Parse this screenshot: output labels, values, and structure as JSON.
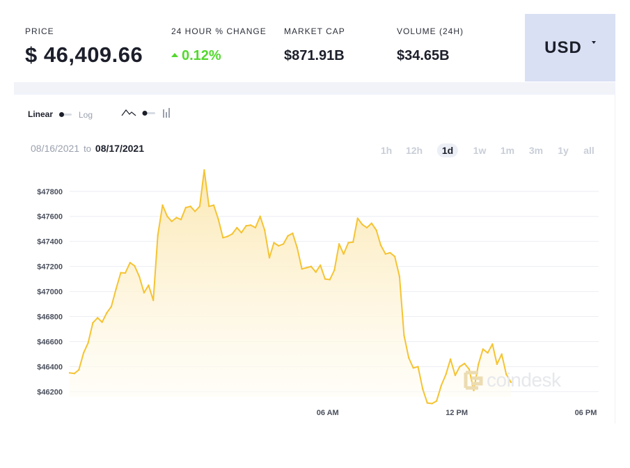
{
  "stats": {
    "price": {
      "label": "PRICE",
      "value": "$ 46,409.66"
    },
    "change": {
      "label": "24 HOUR % CHANGE",
      "value": "0.12%"
    },
    "market_cap": {
      "label": "MARKET CAP",
      "value": "$871.91B"
    },
    "volume": {
      "label": "VOLUME (24H)",
      "value": "$34.65B"
    }
  },
  "currency": {
    "label": "USD"
  },
  "controls": {
    "scale_linear": "Linear",
    "scale_log": "Log",
    "scale_selected": "Linear",
    "chart_type_selected": "line"
  },
  "dates": {
    "from": "08/16/2021",
    "to_word": "to",
    "to": "08/17/2021"
  },
  "ranges": [
    {
      "label": "1h",
      "active": false
    },
    {
      "label": "12h",
      "active": false
    },
    {
      "label": "1d",
      "active": true
    },
    {
      "label": "1w",
      "active": false
    },
    {
      "label": "1m",
      "active": false
    },
    {
      "label": "3m",
      "active": false
    },
    {
      "label": "1y",
      "active": false
    },
    {
      "label": "all",
      "active": false
    }
  ],
  "watermark": {
    "text": "coindesk"
  },
  "colors": {
    "line": "#f5c332",
    "fill_top": "#fbe7b0",
    "fill_bottom": "#fffdf6",
    "positive": "#52d82c",
    "currency_bg": "#d9e0f4",
    "grid": "#eceef2"
  },
  "chart_data": {
    "type": "area",
    "title": "",
    "xlabel": "",
    "ylabel": "",
    "x_unit": "hours since 08/16/2021 18:00 (local)",
    "x_ticks": [
      {
        "label": "06 AM",
        "x": 12
      },
      {
        "label": "12 PM",
        "x": 18
      },
      {
        "label": "06 PM",
        "x": 24
      }
    ],
    "xlim": [
      0,
      24.6
    ],
    "y_ticks": [
      {
        "label": "$46200",
        "v": 46200
      },
      {
        "label": "$46400",
        "v": 46400
      },
      {
        "label": "$46600",
        "v": 46600
      },
      {
        "label": "$46800",
        "v": 46800
      },
      {
        "label": "$47000",
        "v": 47000
      },
      {
        "label": "$47200",
        "v": 47200
      },
      {
        "label": "$47400",
        "v": 47400
      },
      {
        "label": "$47600",
        "v": 47600
      },
      {
        "label": "$47800",
        "v": 47800
      }
    ],
    "ylim": [
      46130,
      47910
    ],
    "grid": true,
    "series": [
      {
        "values": [
          [
            0.0,
            46350
          ],
          [
            0.22,
            46345
          ],
          [
            0.43,
            46375
          ],
          [
            0.65,
            46510
          ],
          [
            0.86,
            46590
          ],
          [
            1.08,
            46750
          ],
          [
            1.3,
            46790
          ],
          [
            1.51,
            46755
          ],
          [
            1.73,
            46830
          ],
          [
            1.94,
            46880
          ],
          [
            2.16,
            47020
          ],
          [
            2.38,
            47150
          ],
          [
            2.59,
            47148
          ],
          [
            2.81,
            47230
          ],
          [
            3.02,
            47205
          ],
          [
            3.24,
            47120
          ],
          [
            3.46,
            46990
          ],
          [
            3.67,
            47050
          ],
          [
            3.89,
            46930
          ],
          [
            4.1,
            47450
          ],
          [
            4.32,
            47690
          ],
          [
            4.54,
            47600
          ],
          [
            4.75,
            47560
          ],
          [
            4.97,
            47590
          ],
          [
            5.18,
            47575
          ],
          [
            5.4,
            47670
          ],
          [
            5.62,
            47680
          ],
          [
            5.83,
            47640
          ],
          [
            6.05,
            47680
          ],
          [
            6.26,
            47970
          ],
          [
            6.48,
            47680
          ],
          [
            6.7,
            47690
          ],
          [
            6.91,
            47580
          ],
          [
            7.13,
            47430
          ],
          [
            7.34,
            47440
          ],
          [
            7.56,
            47460
          ],
          [
            7.78,
            47510
          ],
          [
            7.99,
            47470
          ],
          [
            8.21,
            47525
          ],
          [
            8.42,
            47530
          ],
          [
            8.64,
            47510
          ],
          [
            8.86,
            47600
          ],
          [
            9.07,
            47490
          ],
          [
            9.29,
            47270
          ],
          [
            9.5,
            47390
          ],
          [
            9.72,
            47365
          ],
          [
            9.94,
            47380
          ],
          [
            10.15,
            47445
          ],
          [
            10.37,
            47465
          ],
          [
            10.58,
            47350
          ],
          [
            10.8,
            47180
          ],
          [
            11.02,
            47190
          ],
          [
            11.23,
            47200
          ],
          [
            11.45,
            47155
          ],
          [
            11.66,
            47210
          ],
          [
            11.88,
            47100
          ],
          [
            12.1,
            47095
          ],
          [
            12.31,
            47170
          ],
          [
            12.53,
            47380
          ],
          [
            12.74,
            47300
          ],
          [
            12.96,
            47390
          ],
          [
            13.18,
            47395
          ],
          [
            13.39,
            47585
          ],
          [
            13.61,
            47535
          ],
          [
            13.82,
            47510
          ],
          [
            14.04,
            47545
          ],
          [
            14.26,
            47490
          ],
          [
            14.47,
            47370
          ],
          [
            14.69,
            47300
          ],
          [
            14.9,
            47310
          ],
          [
            15.12,
            47280
          ],
          [
            15.34,
            47120
          ],
          [
            15.55,
            46650
          ],
          [
            15.77,
            46470
          ],
          [
            15.98,
            46390
          ],
          [
            16.2,
            46400
          ],
          [
            16.42,
            46220
          ],
          [
            16.63,
            46110
          ],
          [
            16.85,
            46105
          ],
          [
            17.06,
            46125
          ],
          [
            17.28,
            46250
          ],
          [
            17.5,
            46340
          ],
          [
            17.71,
            46460
          ],
          [
            17.93,
            46330
          ],
          [
            18.14,
            46400
          ],
          [
            18.36,
            46425
          ],
          [
            18.58,
            46380
          ],
          [
            18.79,
            46210
          ],
          [
            19.01,
            46420
          ],
          [
            19.22,
            46540
          ],
          [
            19.44,
            46510
          ],
          [
            19.66,
            46580
          ],
          [
            19.87,
            46420
          ],
          [
            20.09,
            46500
          ],
          [
            20.3,
            46340
          ],
          [
            20.52,
            46275
          ]
        ]
      }
    ]
  }
}
